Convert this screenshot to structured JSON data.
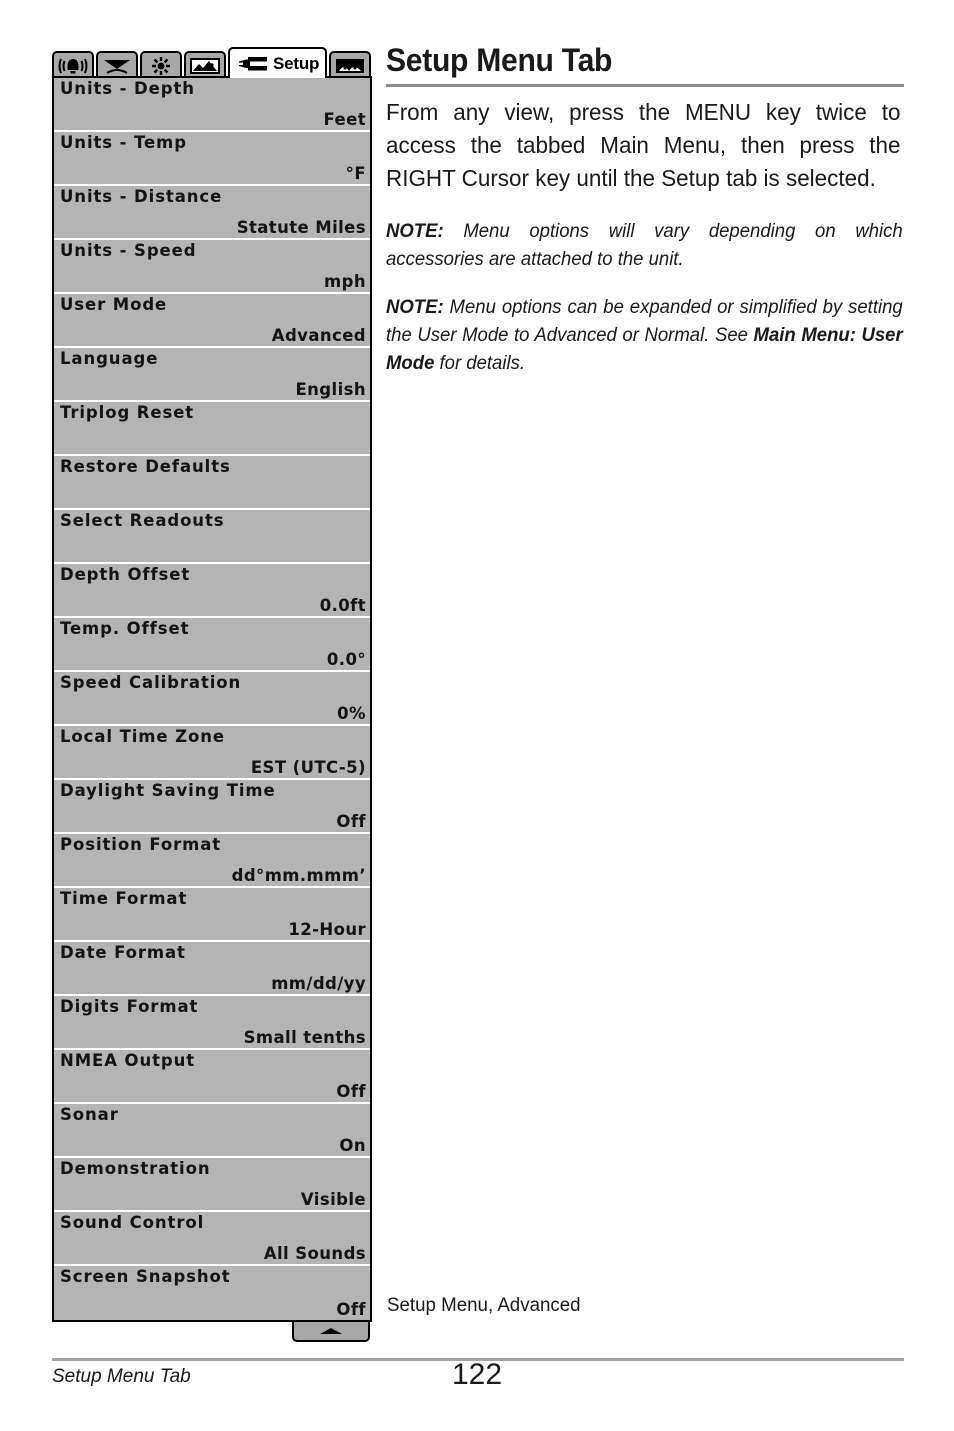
{
  "page": {
    "title": "Setup Menu Tab",
    "intro": "From any view, press the MENU key twice to access the tabbed Main Menu, then press the RIGHT Cursor key until the Setup tab is selected.",
    "notes": [
      {
        "lead": "NOTE:",
        "text": " Menu options will vary depending on which accessories are attached to the unit."
      },
      {
        "lead": "NOTE:",
        "text_before": " Menu options can be expanded or simplified by setting the User Mode to Advanced or Normal. See ",
        "bold_ref": "Main Menu: User Mode",
        "text_after": " for details."
      }
    ],
    "figure_caption": "Setup Menu, Advanced",
    "footer": {
      "running_head": "Setup Menu Tab",
      "page_number": "122"
    }
  },
  "lcd": {
    "tabs": [
      {
        "name": "alarms-tab",
        "icon": "bell-alarm-icon",
        "label": "",
        "active": false
      },
      {
        "name": "sonar-tab",
        "icon": "sonar-cone-icon",
        "label": "",
        "active": false
      },
      {
        "name": "display-tab",
        "icon": "sun-brightness-icon",
        "label": "",
        "active": false
      },
      {
        "name": "chart-tab",
        "icon": "chart-map-icon",
        "label": "",
        "active": false
      },
      {
        "name": "setup-tab",
        "icon": "wrench-screwdriver-icon",
        "label": "Setup",
        "active": true
      },
      {
        "name": "views-tab",
        "icon": "views-landscape-icon",
        "label": "",
        "active": false
      }
    ],
    "scroll_indicator_icon": "scroll-up-arrow-icon",
    "menu_items": [
      {
        "label": "Units - Depth",
        "value": "Feet"
      },
      {
        "label": "Units - Temp",
        "value": "°F"
      },
      {
        "label": "Units - Distance",
        "value": "Statute Miles"
      },
      {
        "label": "Units - Speed",
        "value": "mph"
      },
      {
        "label": "User Mode",
        "value": "Advanced"
      },
      {
        "label": "Language",
        "value": "English"
      },
      {
        "label": "Triplog Reset",
        "value": ""
      },
      {
        "label": "Restore Defaults",
        "value": ""
      },
      {
        "label": "Select Readouts",
        "value": ""
      },
      {
        "label": "Depth Offset",
        "value": "0.0ft"
      },
      {
        "label": "Temp. Offset",
        "value": "0.0°"
      },
      {
        "label": "Speed Calibration",
        "value": "0%"
      },
      {
        "label": "Local Time Zone",
        "value": "EST (UTC-5)"
      },
      {
        "label": "Daylight Saving Time",
        "value": "Off"
      },
      {
        "label": "Position Format",
        "value": "dd°mm.mmm’"
      },
      {
        "label": "Time Format",
        "value": "12-Hour"
      },
      {
        "label": "Date Format",
        "value": "mm/dd/yy"
      },
      {
        "label": "Digits Format",
        "value": "Small tenths"
      },
      {
        "label": "NMEA Output",
        "value": "Off"
      },
      {
        "label": "Sonar",
        "value": "On"
      },
      {
        "label": "Demonstration",
        "value": "Visible"
      },
      {
        "label": "Sound Control",
        "value": "All Sounds"
      },
      {
        "label": "Screen Snapshot",
        "value": "Off"
      }
    ]
  },
  "colors": {
    "lcd_background": "#b4b4b4",
    "lcd_tab_inactive": "#a8a8a8",
    "lcd_tab_active": "#ffffff",
    "rule": "#8c8c8c",
    "text": "#1a1a1a"
  }
}
